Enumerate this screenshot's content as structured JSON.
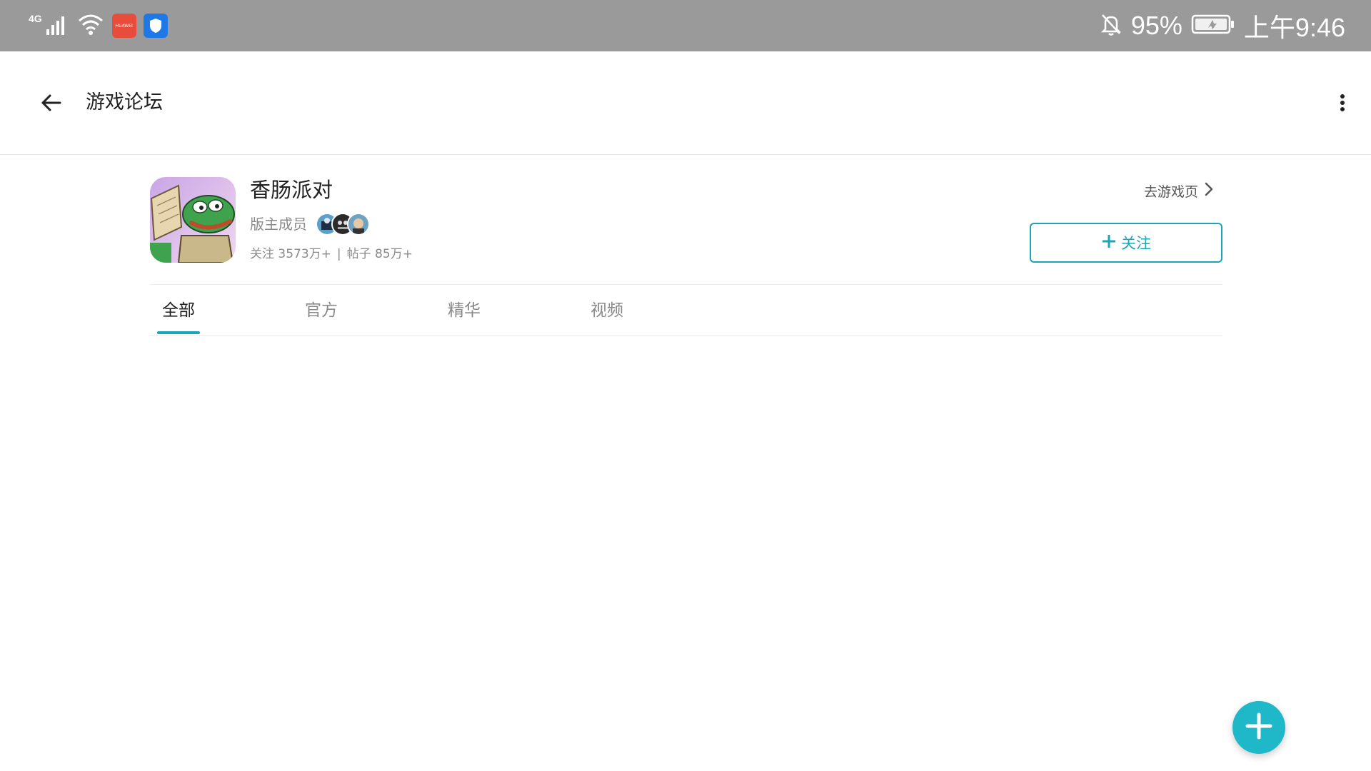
{
  "status_bar": {
    "network": "4G",
    "battery": "95%",
    "time": "上午9:46",
    "huawei_badge": "HUAWEI"
  },
  "app_bar": {
    "title": "游戏论坛"
  },
  "forum": {
    "game_name": "香肠派对",
    "mods_label": "版主成员",
    "followers": "关注 3573万+",
    "separator": "|",
    "posts": "帖子 85万+",
    "goto_game": "去游戏页",
    "follow_label": "关注"
  },
  "tabs": [
    {
      "label": "全部"
    },
    {
      "label": "官方"
    },
    {
      "label": "精华"
    },
    {
      "label": "视频"
    }
  ],
  "colors": {
    "accent": "#1aa6b7",
    "fab": "#1fb8c8",
    "status_bar": "#9a9a9a"
  },
  "icons": {
    "back": "arrow-left-icon",
    "more": "more-vertical-icon",
    "chevron": "chevron-right-icon",
    "plus": "plus-icon"
  }
}
